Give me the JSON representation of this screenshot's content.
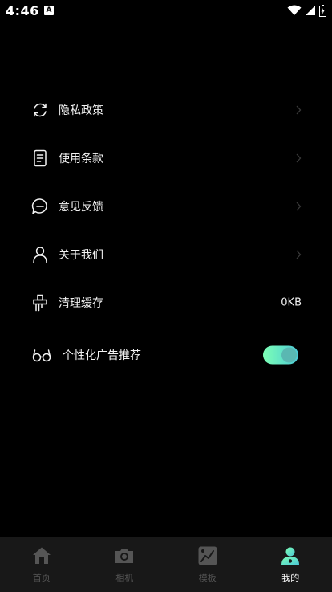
{
  "status_bar": {
    "time": "4:46",
    "app_icon_letter": "A",
    "icons": [
      "wifi-icon",
      "signal-icon",
      "battery-icon"
    ]
  },
  "menu": {
    "items": [
      {
        "label": "隐私政策",
        "icon": "refresh-cycle-icon",
        "trailing": "chevron"
      },
      {
        "label": "使用条款",
        "icon": "document-icon",
        "trailing": "chevron"
      },
      {
        "label": "意见反馈",
        "icon": "chat-bubble-icon",
        "trailing": "chevron"
      },
      {
        "label": "关于我们",
        "icon": "person-icon",
        "trailing": "chevron"
      },
      {
        "label": "清理缓存",
        "icon": "broom-icon",
        "trailing": "value",
        "value": "0KB"
      }
    ],
    "ad_recommendation": {
      "label": "个性化广告推荐",
      "icon": "glasses-icon",
      "toggle_on": true
    }
  },
  "tabbar": {
    "tabs": [
      {
        "label": "首页",
        "icon": "home-icon",
        "active": false
      },
      {
        "label": "相机",
        "icon": "camera-icon",
        "active": false
      },
      {
        "label": "模板",
        "icon": "template-icon",
        "active": false
      },
      {
        "label": "我的",
        "icon": "profile-icon",
        "active": true
      }
    ]
  },
  "colors": {
    "background": "#000000",
    "tabbar_background": "#181818",
    "text": "#f2f2f2",
    "inactive_tab": "#555555",
    "accent_gradient_start": "#7dffb5",
    "accent_gradient_end": "#4cc9d6"
  }
}
